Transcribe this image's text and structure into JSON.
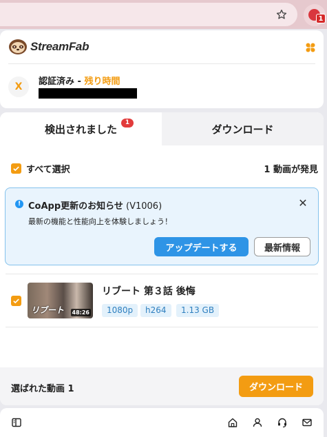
{
  "browser": {
    "icons": [
      "star-icon",
      "extension-icon"
    ],
    "extension_badge": "1"
  },
  "header": {
    "logo_text": "StreamFab",
    "avatar_letter": "X",
    "auth_status": "認証済み - ",
    "remaining_label": "残り時間"
  },
  "tabs": [
    {
      "label": "検出されました",
      "badge": "1",
      "active": true
    },
    {
      "label": "ダウンロード",
      "active": false
    }
  ],
  "selection": {
    "select_all_label": "すべて選択",
    "found_count": "1 動画が発見"
  },
  "notice": {
    "title": "CoApp更新のお知らせ",
    "version": " (V1006)",
    "body": "最新の機能と性能向上を体験しましょう！",
    "update_button": "アップデートする",
    "news_button": "最新情報",
    "close_glyph": "✕"
  },
  "videos": [
    {
      "title": "リブート 第３話 後悔",
      "duration": "48:26",
      "thumbnail_caption": "リブート",
      "tags": [
        "1080p",
        "h264",
        "1.13 GB"
      ],
      "checked": true
    }
  ],
  "footer": {
    "selected_label": "選ばれた動画 1",
    "download_button": "ダウンロード"
  },
  "colors": {
    "accent": "#f39c12",
    "primary_blue": "#2e94e6",
    "badge_red": "#e23b3b"
  },
  "bottom_nav": [
    "sidebar-icon",
    "home-icon",
    "user-icon",
    "support-icon",
    "mail-icon"
  ]
}
